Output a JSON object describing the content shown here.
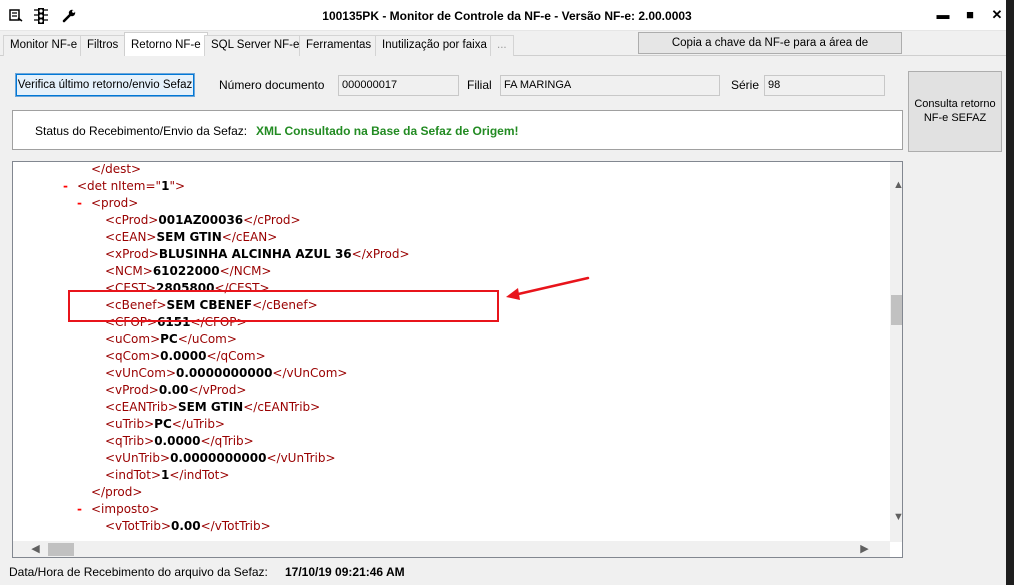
{
  "window": {
    "title": "100135PK - Monitor de Controle da NF-e - Versão NF-e: 2.00.0003",
    "icons": [
      "monitor-icon",
      "traffic-light-icon",
      "wrench-icon"
    ],
    "controls": {
      "minimize": "▬",
      "maximize": "■",
      "close": "✕"
    }
  },
  "tabs": [
    {
      "label": "Monitor NF-e"
    },
    {
      "label": "Filtros"
    },
    {
      "label": "Retorno NF-e",
      "active": true
    },
    {
      "label": "SQL Server NF-e"
    },
    {
      "label": "Ferramentas"
    },
    {
      "label": "Inutilização por faixa"
    },
    {
      "label": "..."
    }
  ],
  "copy_button": "Copia a chave da NF-e para a área de transferência",
  "form": {
    "verify_button": "Verifica último retorno/envio Sefaz",
    "numero_label": "Número documento",
    "numero_value": "000000017",
    "filial_label": "Filial",
    "filial_value": "FA MARINGA",
    "serie_label": "Série",
    "serie_value": "98",
    "consult_button": "Consulta retorno NF-e SEFAZ"
  },
  "status": {
    "label": "Status do Recebimento/Envio da Sefaz:",
    "value": "XML Consultado na Base da Sefaz de Origem!"
  },
  "xml_lines": [
    {
      "marker": "",
      "open": "</dest>",
      "value": "",
      "close": ""
    },
    {
      "marker": "-",
      "open": "<det nItem=\"",
      "value": "1",
      "close": "\">"
    },
    {
      "marker": "-",
      "open": "<prod>",
      "value": "",
      "close": ""
    },
    {
      "marker": "",
      "open": "<cProd>",
      "value": "001AZ00036",
      "close": "</cProd>"
    },
    {
      "marker": "",
      "open": "<cEAN>",
      "value": "SEM GTIN",
      "close": "</cEAN>"
    },
    {
      "marker": "",
      "open": "<xProd>",
      "value": "BLUSINHA ALCINHA AZUL 36",
      "close": "</xProd>"
    },
    {
      "marker": "",
      "open": "<NCM>",
      "value": "61022000",
      "close": "</NCM>"
    },
    {
      "marker": "",
      "open": "<CEST>",
      "value": "2805800",
      "close": "</CEST>"
    },
    {
      "marker": "",
      "open": "<cBenef>",
      "value": "SEM CBENEF",
      "close": "</cBenef>"
    },
    {
      "marker": "",
      "open": "<CFOP>",
      "value": "6151",
      "close": "</CFOP>"
    },
    {
      "marker": "",
      "open": "<uCom>",
      "value": "PC",
      "close": "</uCom>"
    },
    {
      "marker": "",
      "open": "<qCom>",
      "value": "0.0000",
      "close": "</qCom>"
    },
    {
      "marker": "",
      "open": "<vUnCom>",
      "value": "0.0000000000",
      "close": "</vUnCom>"
    },
    {
      "marker": "",
      "open": "<vProd>",
      "value": "0.00",
      "close": "</vProd>"
    },
    {
      "marker": "",
      "open": "<cEANTrib>",
      "value": "SEM GTIN",
      "close": "</cEANTrib>"
    },
    {
      "marker": "",
      "open": "<uTrib>",
      "value": "PC",
      "close": "</uTrib>"
    },
    {
      "marker": "",
      "open": "<qTrib>",
      "value": "0.0000",
      "close": "</qTrib>"
    },
    {
      "marker": "",
      "open": "<vUnTrib>",
      "value": "0.0000000000",
      "close": "</vUnTrib>"
    },
    {
      "marker": "",
      "open": "<indTot>",
      "value": "1",
      "close": "</indTot>"
    },
    {
      "marker": "",
      "open": "</prod>",
      "value": "",
      "close": ""
    },
    {
      "marker": "-",
      "open": "<imposto>",
      "value": "",
      "close": ""
    },
    {
      "marker": "",
      "open": "<vTotTrib>",
      "value": "0.00",
      "close": "</vTotTrib>"
    }
  ],
  "footer": {
    "label": "Data/Hora de Recebimento do arquivo da Sefaz:",
    "value": "17/10/19 09:21:46 AM"
  },
  "colors": {
    "status_green": "#228b22",
    "xml_tag": "#990000",
    "annotation_red": "#e8141b"
  }
}
